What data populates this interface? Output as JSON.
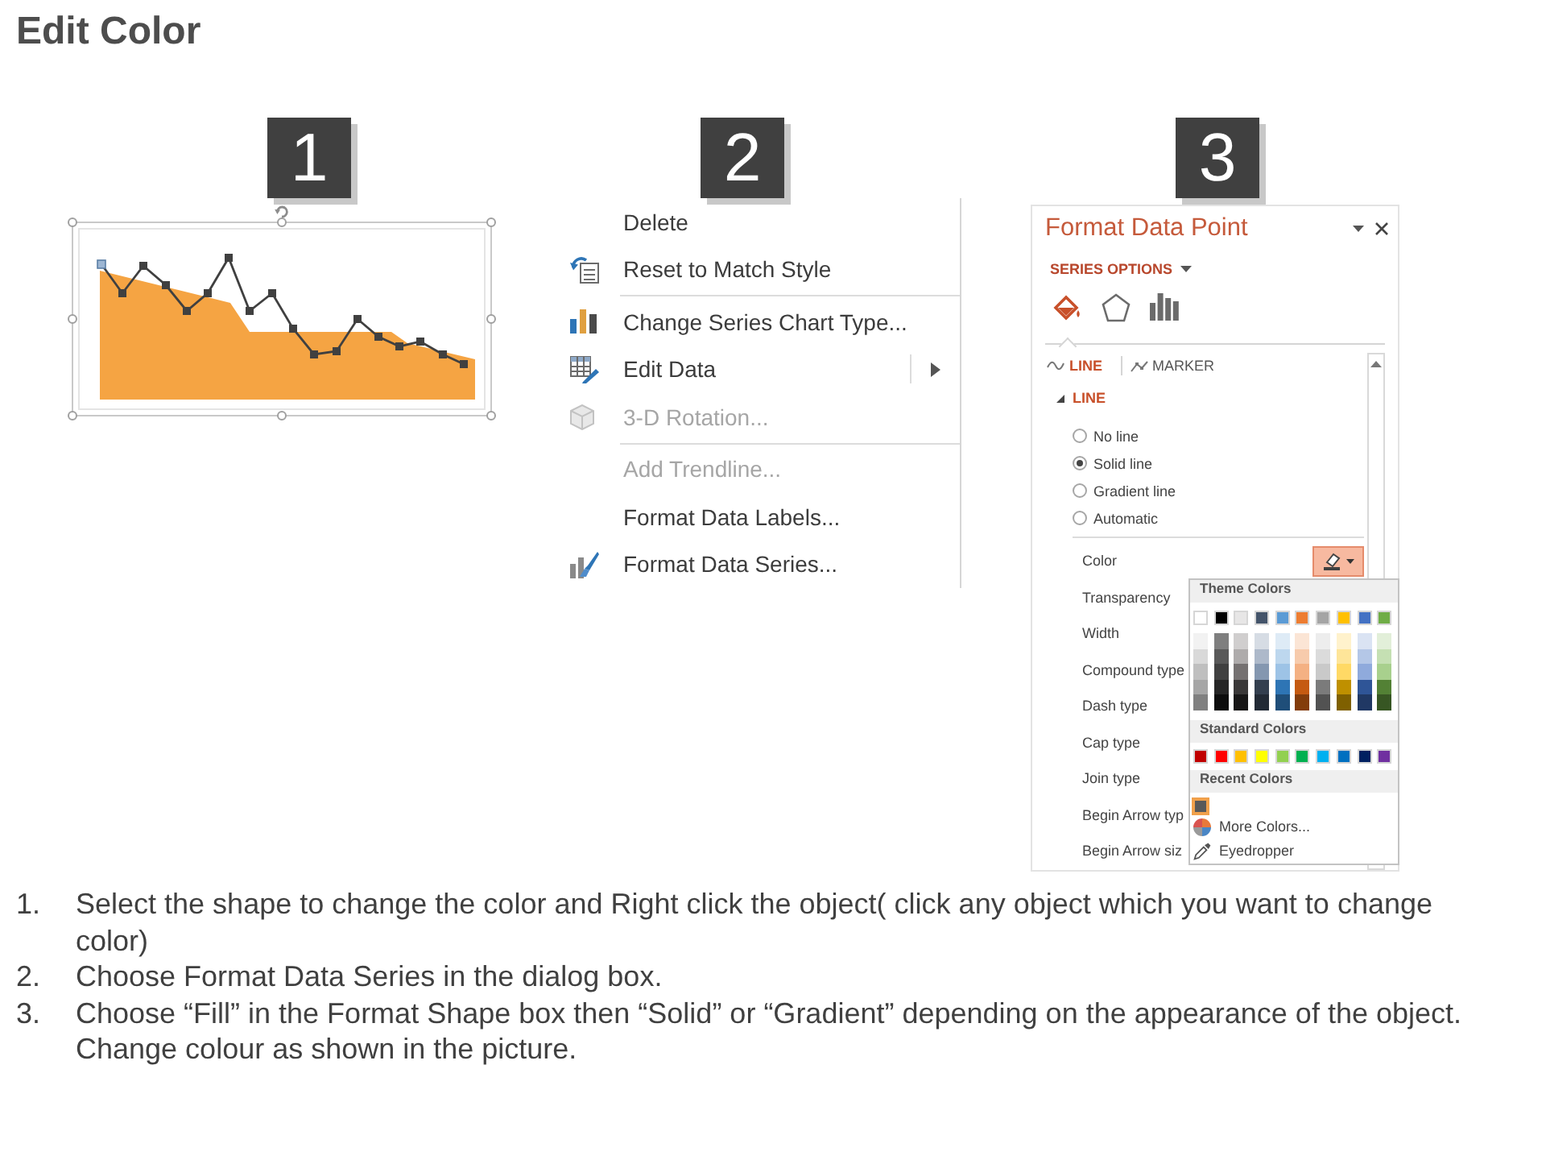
{
  "title": "Edit Color",
  "steps": [
    {
      "number": "1"
    },
    {
      "number": "2"
    },
    {
      "number": "3"
    }
  ],
  "context_menu": {
    "groups": [
      [
        {
          "label": "Delete",
          "disabled": false,
          "submenu": false
        },
        {
          "label": "Reset to Match Style",
          "disabled": false,
          "submenu": false
        }
      ],
      [
        {
          "label": "Change Series Chart Type...",
          "disabled": false,
          "submenu": false
        },
        {
          "label": "Edit Data",
          "disabled": false,
          "submenu": true
        },
        {
          "label": "3-D Rotation...",
          "disabled": true,
          "submenu": false
        }
      ],
      [
        {
          "label": "Add Trendline...",
          "disabled": true,
          "submenu": false
        },
        {
          "label": "Format Data Labels...",
          "disabled": false,
          "submenu": false
        },
        {
          "label": "Format Data Series...",
          "disabled": false,
          "submenu": false
        }
      ]
    ]
  },
  "format_pane": {
    "title": "Format Data Point",
    "options_menu": "SERIES OPTIONS",
    "category_tabs": [
      {
        "selected": true
      },
      {
        "selected": false
      },
      {
        "selected": false
      }
    ],
    "sub_tabs": [
      {
        "label": "LINE",
        "selected": true
      },
      {
        "label": "MARKER",
        "selected": false
      }
    ],
    "section": {
      "label": "LINE",
      "expanded": true
    },
    "line_options": [
      {
        "label": "No line",
        "selected": false
      },
      {
        "label": "Solid line",
        "selected": true
      },
      {
        "label": "Gradient line",
        "selected": false
      },
      {
        "label": "Automatic",
        "selected": false
      }
    ],
    "properties": [
      {
        "label": "Color",
        "kind": "color"
      },
      {
        "label": "Transparency",
        "kind": "text"
      },
      {
        "label": "Width",
        "kind": "text"
      },
      {
        "label": "Compound type",
        "kind": "text"
      },
      {
        "label": "Dash type",
        "kind": "text"
      },
      {
        "label": "Cap type",
        "kind": "text"
      },
      {
        "label": "Join type",
        "kind": "text"
      },
      {
        "label": "Begin Arrow typ",
        "kind": "text"
      },
      {
        "label": "Begin Arrow siz",
        "kind": "text"
      }
    ],
    "color_picker": {
      "theme_heading": "Theme Colors",
      "theme_colors": [
        {
          "color": "#ffffff",
          "shades": [
            {
              "color": "#f2f2f2"
            },
            {
              "color": "#d9d9d9"
            },
            {
              "color": "#bfbfbf"
            },
            {
              "color": "#a6a6a6"
            },
            {
              "color": "#808080"
            }
          ]
        },
        {
          "color": "#000000",
          "shades": [
            {
              "color": "#7f7f7f"
            },
            {
              "color": "#595959"
            },
            {
              "color": "#404040"
            },
            {
              "color": "#262626"
            },
            {
              "color": "#0d0d0d"
            }
          ]
        },
        {
          "color": "#e7e6e6",
          "shades": [
            {
              "color": "#d0cece"
            },
            {
              "color": "#aeabab"
            },
            {
              "color": "#757171"
            },
            {
              "color": "#3a3838"
            },
            {
              "color": "#171616"
            }
          ]
        },
        {
          "color": "#44546a",
          "shades": [
            {
              "color": "#d6dce4"
            },
            {
              "color": "#adb9ca"
            },
            {
              "color": "#8497b0"
            },
            {
              "color": "#333f4f"
            },
            {
              "color": "#222a35"
            }
          ]
        },
        {
          "color": "#5b9bd5",
          "shades": [
            {
              "color": "#deebf6"
            },
            {
              "color": "#bdd7ee"
            },
            {
              "color": "#9dc3e6"
            },
            {
              "color": "#2e75b5"
            },
            {
              "color": "#1f4e79"
            }
          ]
        },
        {
          "color": "#ed7d31",
          "shades": [
            {
              "color": "#fbe5d5"
            },
            {
              "color": "#f7cbac"
            },
            {
              "color": "#f4b183"
            },
            {
              "color": "#c55a11"
            },
            {
              "color": "#833c0b"
            }
          ]
        },
        {
          "color": "#a5a5a5",
          "shades": [
            {
              "color": "#ededed"
            },
            {
              "color": "#dbdbdb"
            },
            {
              "color": "#c9c9c9"
            },
            {
              "color": "#7b7b7b"
            },
            {
              "color": "#525252"
            }
          ]
        },
        {
          "color": "#ffc000",
          "shades": [
            {
              "color": "#fff2cc"
            },
            {
              "color": "#fee599"
            },
            {
              "color": "#ffd965"
            },
            {
              "color": "#bf9000"
            },
            {
              "color": "#7f6000"
            }
          ]
        },
        {
          "color": "#4472c4",
          "shades": [
            {
              "color": "#dae3f3"
            },
            {
              "color": "#b4c7e7"
            },
            {
              "color": "#8faadc"
            },
            {
              "color": "#2f5597"
            },
            {
              "color": "#203864"
            }
          ]
        },
        {
          "color": "#70ad47",
          "shades": [
            {
              "color": "#e2efd9"
            },
            {
              "color": "#c5e0b3"
            },
            {
              "color": "#a8d08d"
            },
            {
              "color": "#538135"
            },
            {
              "color": "#375623"
            }
          ]
        }
      ],
      "standard_heading": "Standard Colors",
      "standard_colors": [
        {
          "color": "#c00000"
        },
        {
          "color": "#ff0000"
        },
        {
          "color": "#ffc000"
        },
        {
          "color": "#ffff00"
        },
        {
          "color": "#92d050"
        },
        {
          "color": "#00b050"
        },
        {
          "color": "#00b0f0"
        },
        {
          "color": "#0070c0"
        },
        {
          "color": "#002060"
        },
        {
          "color": "#7030a0"
        }
      ],
      "recent_heading": "Recent Colors",
      "recent_colors": [
        {
          "color": "#595959",
          "selected": true
        }
      ],
      "commands": [
        {
          "label": "More Colors..."
        },
        {
          "label": "Eyedropper"
        }
      ]
    }
  },
  "instructions": [
    {
      "number": "1.",
      "text": "Select the shape to change the color and Right click the object( click any object which you want to change color)"
    },
    {
      "number": "2.",
      "text": "Choose Format Data Series in the dialog box."
    },
    {
      "number": "3.",
      "text": "Choose “Fill” in the Format Shape box then “Solid” or “Gradient” depending on the appearance of the object. Change colour as shown in the picture."
    }
  ]
}
